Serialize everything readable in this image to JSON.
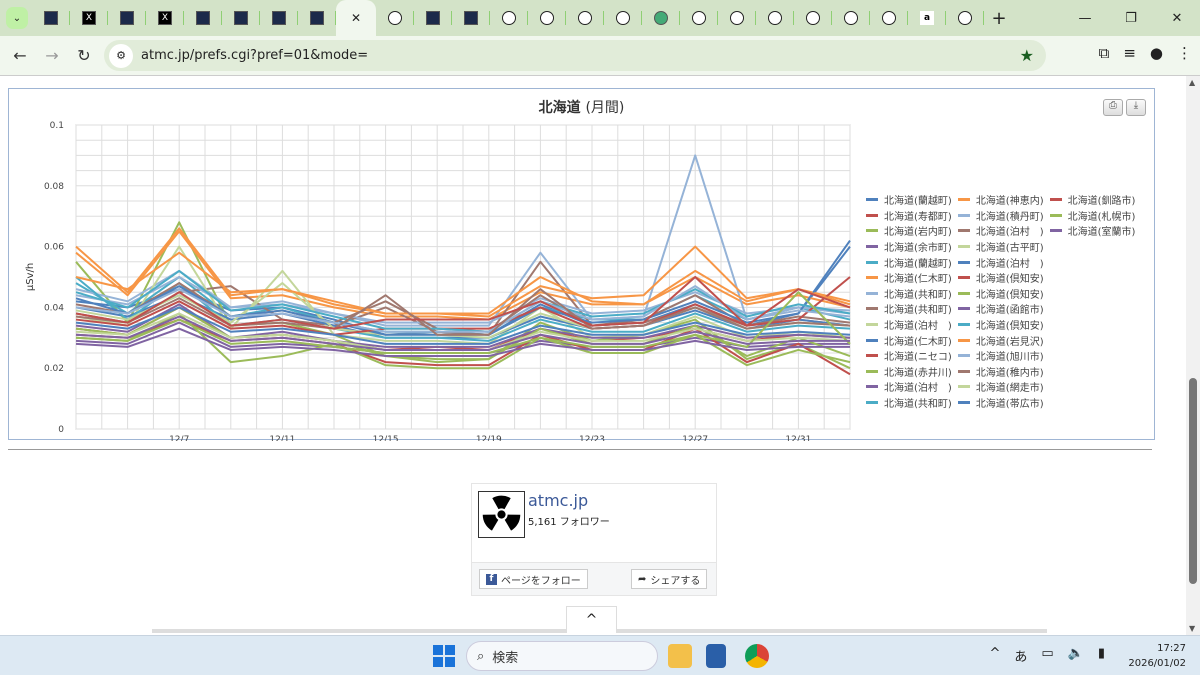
{
  "browser": {
    "tabs": [
      {
        "icon": "site-icon"
      },
      {
        "icon": "x-icon"
      },
      {
        "icon": "site-icon"
      },
      {
        "icon": "x-icon"
      },
      {
        "icon": "site-icon"
      },
      {
        "icon": "site-icon"
      },
      {
        "icon": "site-icon"
      },
      {
        "icon": "site-icon"
      },
      {
        "icon": "close-icon",
        "active": true
      },
      {
        "icon": "circle-icon"
      },
      {
        "icon": "site-icon"
      },
      {
        "icon": "site-icon"
      },
      {
        "icon": "circle-icon"
      },
      {
        "icon": "circle-icon"
      },
      {
        "icon": "circle-icon"
      },
      {
        "icon": "circle-icon"
      },
      {
        "icon": "globe-icon"
      },
      {
        "icon": "circle-icon"
      },
      {
        "icon": "circle-icon"
      },
      {
        "icon": "circle-icon"
      },
      {
        "icon": "circle-icon"
      },
      {
        "icon": "circle-icon"
      },
      {
        "icon": "circle-icon"
      },
      {
        "icon": "amazon-icon",
        "label": "a"
      },
      {
        "icon": "circle-icon"
      }
    ],
    "url": "atmc.jp/prefs.cgi?pref=01&mode=",
    "new_tab": "+"
  },
  "chart_data": {
    "type": "line",
    "title": "北海道",
    "title_suffix": "(月間)",
    "ylabel": "μSv/h",
    "ylim": [
      0,
      0.1
    ],
    "yticks": [
      "0",
      "0.02",
      "0.04",
      "0.06",
      "0.08",
      "0.1"
    ],
    "xlim_days": [
      0,
      30
    ],
    "x_day_offsets": [
      0,
      2,
      4,
      6,
      8,
      10,
      12,
      14,
      16,
      18,
      20,
      22,
      24,
      26,
      28,
      30
    ],
    "xticks": [
      {
        "label": "12/7",
        "day": 4
      },
      {
        "label": "12/11",
        "day": 8
      },
      {
        "label": "12/15",
        "day": 12
      },
      {
        "label": "12/19",
        "day": 16
      },
      {
        "label": "12/23",
        "day": 20
      },
      {
        "label": "12/27",
        "day": 24
      },
      {
        "label": "12/31",
        "day": 28
      }
    ],
    "colors": [
      "#4F81BD",
      "#C0504D",
      "#9BBB59",
      "#8064A2",
      "#4BACC6",
      "#F79646",
      "#95B3D7",
      "#A0786F",
      "#C3D69B"
    ],
    "series": [
      {
        "name": "北海道(蘭越町)",
        "values": [
          0.042,
          0.04,
          0.046,
          0.039,
          0.04,
          0.036,
          0.031,
          0.032,
          0.031,
          0.041,
          0.034,
          0.035,
          0.041,
          0.034,
          0.038,
          0.06
        ]
      },
      {
        "name": "北海道(寿都町)",
        "values": [
          0.033,
          0.031,
          0.04,
          0.03,
          0.031,
          0.029,
          0.026,
          0.027,
          0.026,
          0.033,
          0.029,
          0.03,
          0.033,
          0.029,
          0.031,
          0.03
        ]
      },
      {
        "name": "北海道(岩内町)",
        "values": [
          0.055,
          0.035,
          0.068,
          0.034,
          0.035,
          0.031,
          0.024,
          0.022,
          0.023,
          0.035,
          0.029,
          0.031,
          0.036,
          0.023,
          0.028,
          0.02
        ]
      },
      {
        "name": "北海道(余市町)",
        "values": [
          0.029,
          0.028,
          0.035,
          0.027,
          0.028,
          0.027,
          0.025,
          0.025,
          0.025,
          0.029,
          0.027,
          0.027,
          0.03,
          0.027,
          0.028,
          0.028
        ]
      },
      {
        "name": "北海道(蘭越町)",
        "values": [
          0.048,
          0.038,
          0.05,
          0.037,
          0.04,
          0.035,
          0.032,
          0.032,
          0.031,
          0.04,
          0.036,
          0.036,
          0.044,
          0.036,
          0.04,
          0.036
        ]
      },
      {
        "name": "北海道(仁木町)",
        "values": [
          0.058,
          0.044,
          0.065,
          0.043,
          0.044,
          0.04,
          0.037,
          0.037,
          0.036,
          0.045,
          0.041,
          0.041,
          0.05,
          0.041,
          0.044,
          0.04
        ]
      },
      {
        "name": "北海道(共和町)",
        "values": [
          0.046,
          0.042,
          0.052,
          0.04,
          0.042,
          0.038,
          0.034,
          0.034,
          0.034,
          0.058,
          0.036,
          0.037,
          0.09,
          0.036,
          0.04,
          0.038
        ]
      },
      {
        "name": "北海道(共和町)",
        "values": [
          0.038,
          0.035,
          0.045,
          0.047,
          0.036,
          0.034,
          0.04,
          0.032,
          0.031,
          0.055,
          0.034,
          0.035,
          0.04,
          0.034,
          0.036,
          0.034
        ]
      },
      {
        "name": "北海道(泊村　)",
        "values": [
          0.037,
          0.034,
          0.06,
          0.033,
          0.052,
          0.031,
          0.029,
          0.029,
          0.028,
          0.04,
          0.03,
          0.031,
          0.037,
          0.03,
          0.032,
          0.03
        ]
      },
      {
        "name": "北海道(仁木町)",
        "values": [
          0.04,
          0.037,
          0.044,
          0.036,
          0.038,
          0.034,
          0.03,
          0.03,
          0.03,
          0.037,
          0.033,
          0.034,
          0.039,
          0.033,
          0.036,
          0.034
        ]
      },
      {
        "name": "北海道(ニセコ)",
        "values": [
          0.031,
          0.03,
          0.036,
          0.029,
          0.03,
          0.028,
          0.022,
          0.021,
          0.021,
          0.031,
          0.026,
          0.026,
          0.033,
          0.022,
          0.028,
          0.018
        ]
      },
      {
        "name": "北海道(赤井川)",
        "values": [
          0.03,
          0.029,
          0.038,
          0.022,
          0.024,
          0.028,
          0.021,
          0.02,
          0.02,
          0.03,
          0.025,
          0.025,
          0.031,
          0.021,
          0.026,
          0.022
        ]
      },
      {
        "name": "北海道(泊村　)",
        "values": [
          0.034,
          0.032,
          0.041,
          0.03,
          0.032,
          0.029,
          0.027,
          0.027,
          0.027,
          0.033,
          0.03,
          0.03,
          0.034,
          0.03,
          0.031,
          0.03
        ]
      },
      {
        "name": "北海道(共和町)",
        "values": [
          0.05,
          0.036,
          0.048,
          0.034,
          0.036,
          0.033,
          0.03,
          0.03,
          0.029,
          0.036,
          0.032,
          0.032,
          0.038,
          0.032,
          0.034,
          0.033
        ]
      },
      {
        "name": "北海道(神恵内)",
        "values": [
          0.06,
          0.045,
          0.066,
          0.044,
          0.046,
          0.041,
          0.038,
          0.038,
          0.037,
          0.047,
          0.043,
          0.044,
          0.06,
          0.043,
          0.046,
          0.042
        ]
      },
      {
        "name": "北海道(積丹町)",
        "values": [
          0.044,
          0.041,
          0.05,
          0.04,
          0.041,
          0.038,
          0.035,
          0.035,
          0.035,
          0.043,
          0.038,
          0.039,
          0.045,
          0.038,
          0.04,
          0.039
        ]
      },
      {
        "name": "北海道(泊村　)",
        "values": [
          0.041,
          0.038,
          0.048,
          0.037,
          0.039,
          0.035,
          0.042,
          0.033,
          0.032,
          0.044,
          0.034,
          0.036,
          0.044,
          0.034,
          0.037,
          0.035
        ]
      },
      {
        "name": "北海道(古平町)",
        "values": [
          0.039,
          0.036,
          0.044,
          0.035,
          0.048,
          0.033,
          0.031,
          0.031,
          0.03,
          0.038,
          0.033,
          0.034,
          0.04,
          0.033,
          0.035,
          0.034
        ]
      },
      {
        "name": "北海道(泊村　)",
        "values": [
          0.043,
          0.038,
          0.047,
          0.037,
          0.039,
          0.035,
          0.031,
          0.031,
          0.031,
          0.04,
          0.035,
          0.036,
          0.042,
          0.035,
          0.038,
          0.062
        ]
      },
      {
        "name": "北海道(倶知安)",
        "values": [
          0.036,
          0.034,
          0.042,
          0.033,
          0.034,
          0.031,
          0.033,
          0.033,
          0.033,
          0.04,
          0.033,
          0.034,
          0.041,
          0.034,
          0.036,
          0.05
        ]
      },
      {
        "name": "北海道(倶知安)",
        "values": [
          0.033,
          0.031,
          0.04,
          0.03,
          0.031,
          0.029,
          0.024,
          0.023,
          0.023,
          0.033,
          0.028,
          0.028,
          0.034,
          0.024,
          0.03,
          0.024
        ]
      },
      {
        "name": "北海道(函館市)",
        "values": [
          0.028,
          0.027,
          0.033,
          0.026,
          0.027,
          0.026,
          0.024,
          0.024,
          0.024,
          0.028,
          0.026,
          0.026,
          0.029,
          0.026,
          0.027,
          0.027
        ]
      },
      {
        "name": "北海道(倶知安)",
        "values": [
          0.045,
          0.04,
          0.052,
          0.039,
          0.041,
          0.037,
          0.033,
          0.033,
          0.032,
          0.042,
          0.037,
          0.038,
          0.046,
          0.037,
          0.041,
          0.038
        ]
      },
      {
        "name": "北海道(岩見沢)",
        "values": [
          0.05,
          0.046,
          0.058,
          0.045,
          0.046,
          0.042,
          0.038,
          0.038,
          0.038,
          0.05,
          0.042,
          0.041,
          0.052,
          0.042,
          0.046,
          0.041
        ]
      },
      {
        "name": "北海道(旭川市)",
        "values": [
          0.04,
          0.038,
          0.046,
          0.037,
          0.038,
          0.035,
          0.032,
          0.032,
          0.032,
          0.042,
          0.036,
          0.037,
          0.047,
          0.036,
          0.039,
          0.037
        ]
      },
      {
        "name": "北海道(稚内市)",
        "values": [
          0.037,
          0.035,
          0.043,
          0.034,
          0.035,
          0.033,
          0.044,
          0.031,
          0.031,
          0.046,
          0.033,
          0.034,
          0.04,
          0.033,
          0.035,
          0.034
        ]
      },
      {
        "name": "北海道(網走市)",
        "values": [
          0.032,
          0.031,
          0.038,
          0.03,
          0.031,
          0.029,
          0.026,
          0.026,
          0.026,
          0.032,
          0.029,
          0.029,
          0.033,
          0.029,
          0.03,
          0.029
        ]
      },
      {
        "name": "北海道(帯広市)",
        "values": [
          0.035,
          0.033,
          0.04,
          0.032,
          0.033,
          0.031,
          0.028,
          0.028,
          0.028,
          0.034,
          0.031,
          0.031,
          0.035,
          0.031,
          0.032,
          0.031
        ]
      },
      {
        "name": "北海道(釧路市)",
        "values": [
          0.038,
          0.035,
          0.045,
          0.034,
          0.036,
          0.033,
          0.036,
          0.036,
          0.036,
          0.042,
          0.034,
          0.035,
          0.05,
          0.034,
          0.046,
          0.04
        ]
      },
      {
        "name": "北海道(札幌市)",
        "values": [
          0.03,
          0.029,
          0.036,
          0.028,
          0.029,
          0.027,
          0.025,
          0.025,
          0.025,
          0.03,
          0.027,
          0.027,
          0.031,
          0.027,
          0.045,
          0.028
        ]
      },
      {
        "name": "北海道(室蘭市)",
        "values": [
          0.031,
          0.03,
          0.037,
          0.029,
          0.03,
          0.028,
          0.026,
          0.026,
          0.026,
          0.031,
          0.028,
          0.028,
          0.032,
          0.028,
          0.029,
          0.029
        ]
      }
    ]
  },
  "chart_buttons": {
    "print": "print-icon",
    "download": "download-icon"
  },
  "facebook": {
    "name": "atmc.jp",
    "followers": "5,161 フォロワー",
    "follow_label": "ページをフォロー",
    "share_label": "シェアする"
  },
  "scroll_top": "^",
  "taskbar": {
    "search_placeholder": "検索",
    "ime": "あ",
    "time": "17:27",
    "date": "2026/01/02"
  }
}
